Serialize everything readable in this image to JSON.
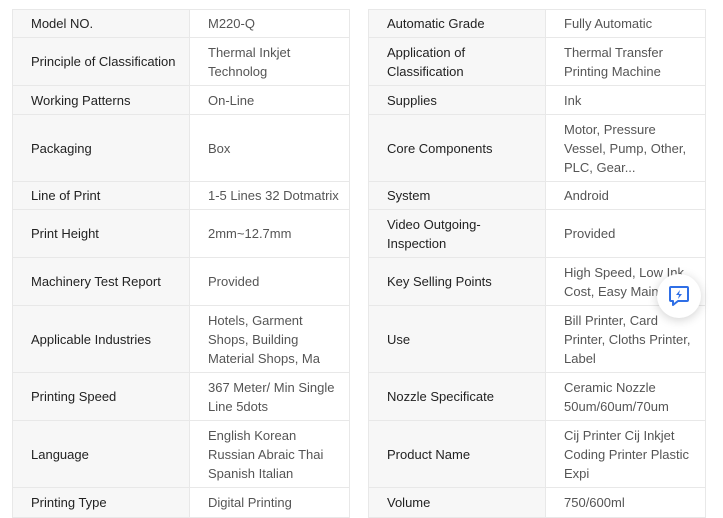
{
  "left_table": [
    {
      "key": "Model NO.",
      "value": "M220-Q"
    },
    {
      "key": "Principle of Classification",
      "value": "Thermal Inkjet Technolog"
    },
    {
      "key": "Working Patterns",
      "value": "On-Line"
    },
    {
      "key": "Packaging",
      "value": "Box"
    },
    {
      "key": "Line of Print",
      "value": "1-5 Lines 32 Dotmatrix"
    },
    {
      "key": "Print Height",
      "value": "2mm~12.7mm"
    },
    {
      "key": "Machinery Test Report",
      "value": "Provided"
    },
    {
      "key": "Applicable Industries",
      "value": "Hotels, Garment Shops, Building Material Shops, Ma"
    },
    {
      "key": "Printing Speed",
      "value": "367 Meter/ Min Single Line 5dots"
    },
    {
      "key": "Language",
      "value": "English Korean Russian Abraic Thai Spanish Italian"
    },
    {
      "key": "Printing Type",
      "value": "Digital Printing"
    }
  ],
  "right_table": [
    {
      "key": "Automatic Grade",
      "value": "Fully Automatic"
    },
    {
      "key": "Application of Classification",
      "value": "Thermal Transfer Printing Machine"
    },
    {
      "key": "Supplies",
      "value": "Ink"
    },
    {
      "key": "Core Components",
      "value": "Motor, Pressure Vessel, Pump, Other, PLC, Gear..."
    },
    {
      "key": "System",
      "value": "Android"
    },
    {
      "key": "Video Outgoing-Inspection",
      "value": "Provided"
    },
    {
      "key": "Key Selling Points",
      "value": "High Speed, Low Ink Cost, Easy Maintai"
    },
    {
      "key": "Use",
      "value": "Bill Printer, Card Printer, Cloths Printer, Label"
    },
    {
      "key": "Nozzle Specificate",
      "value": "Ceramic Nozzle 50um/60um/70um"
    },
    {
      "key": "Product Name",
      "value": "Cij Printer Cij Inkjet Coding Printer Plastic Expi"
    },
    {
      "key": "Volume",
      "value": "750/600ml"
    }
  ],
  "row_heights": [],
  "float_button": {
    "icon": "chat-lightning-icon",
    "color": "#2f6fe6"
  }
}
